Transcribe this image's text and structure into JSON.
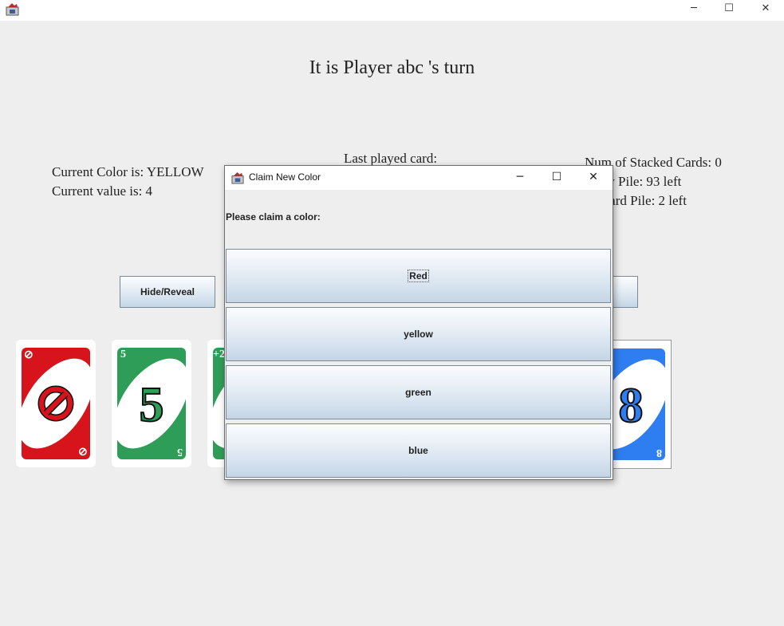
{
  "window": {
    "minimize": "─",
    "maximize": "☐",
    "close": "✕",
    "app_icon": "java-app-icon"
  },
  "game": {
    "turn_text": "It is Player abc 's turn",
    "current_color": "Current Color is: YELLOW",
    "current_value": "Current value is: 4",
    "last_played": "Last played card:",
    "stacked": "Num of Stacked Cards: 0",
    "draw_pile": "Draw Pile: 93 left",
    "discard_pile": "Discard Pile: 2 left",
    "hide_reveal": "Hide/Reveal"
  },
  "hand": [
    {
      "color": "#d7131b",
      "corner": "⊘",
      "center": "⊘",
      "kind": "skip"
    },
    {
      "color": "#2e9d57",
      "corner": "5",
      "center": "5",
      "kind": "number"
    },
    {
      "color": "#2e9d57",
      "corner": "+2",
      "center": "",
      "kind": "draw2"
    },
    {
      "color": "#2f7ef1",
      "corner": "8",
      "center": "8",
      "kind": "number"
    }
  ],
  "dialog": {
    "title": "Claim New Color",
    "minimize": "─",
    "maximize": "☐",
    "close": "✕",
    "prompt": "Please claim a color:",
    "options": [
      "Red",
      "yellow",
      "green",
      "blue"
    ]
  }
}
